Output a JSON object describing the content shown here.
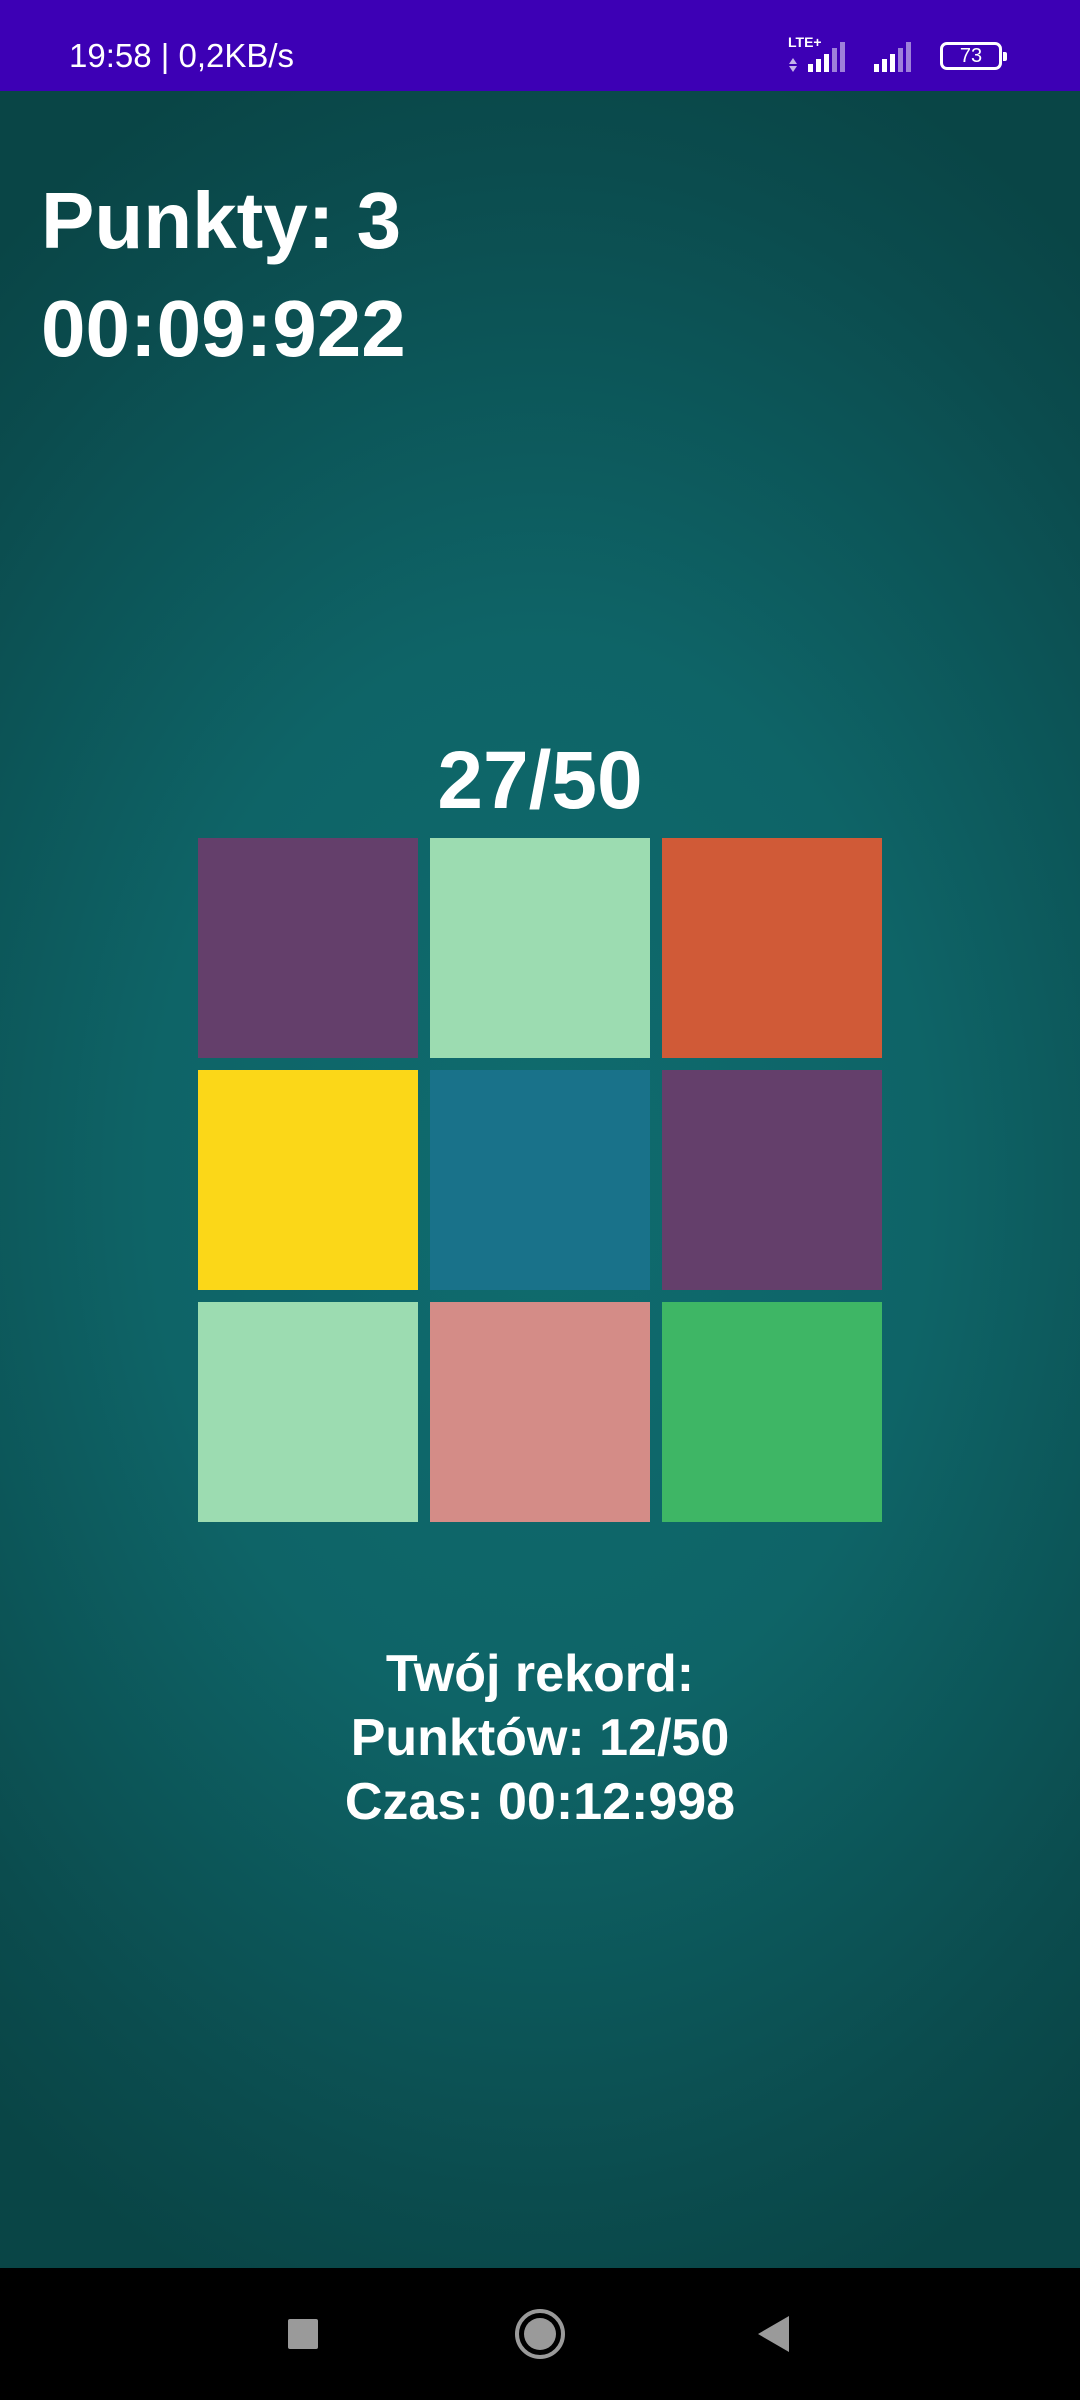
{
  "status_bar": {
    "time_speed": "19:58 | 0,2KB/s",
    "network_label": "LTE+",
    "battery_level": "73",
    "colors": {
      "background": "#3d00b5"
    }
  },
  "game": {
    "score_label": "Punkty: 3",
    "timer": "00:09:922",
    "progress": "27/50",
    "tiles": [
      {
        "color": "#643f6b"
      },
      {
        "color": "#9cdcb1"
      },
      {
        "color": "#d05a37"
      },
      {
        "color": "#fbd718"
      },
      {
        "color": "#19728a"
      },
      {
        "color": "#643f6b"
      },
      {
        "color": "#9cdcb1"
      },
      {
        "color": "#d48c87"
      },
      {
        "color": "#3eb665"
      }
    ]
  },
  "record": {
    "title": "Twój rekord:",
    "points": "Punktów: 12/50",
    "time": "Czas: 00:12:998"
  },
  "nav": {
    "buttons": [
      {
        "icon": "square-recents-icon"
      },
      {
        "icon": "circle-home-icon"
      },
      {
        "icon": "triangle-back-icon"
      }
    ]
  }
}
